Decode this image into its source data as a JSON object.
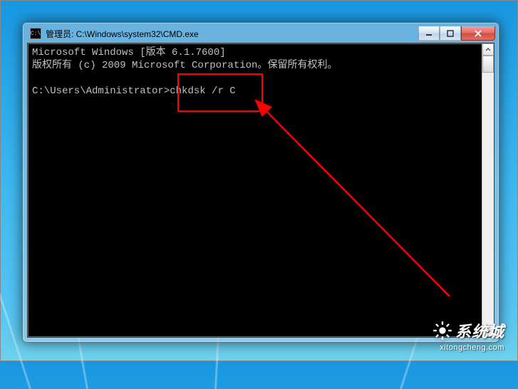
{
  "window": {
    "title_prefix": "管理员: ",
    "title_path": "C:\\Windows\\system32\\CMD.exe",
    "icon_label": "C:\\"
  },
  "controls": {
    "minimize_glyph": "—",
    "close_glyph": "✕"
  },
  "console": {
    "line1": "Microsoft Windows [版本 6.1.7600]",
    "line2": "版权所有 (c) 2009 Microsoft Corporation。保留所有权利。",
    "blank": "",
    "prompt": "C:\\Users\\Administrator>",
    "command": "chkdsk /r C"
  },
  "annotation": {
    "highlight_color": "#ff0000"
  },
  "watermark": {
    "brand": "系统城",
    "url": "xitongcheng.com"
  }
}
